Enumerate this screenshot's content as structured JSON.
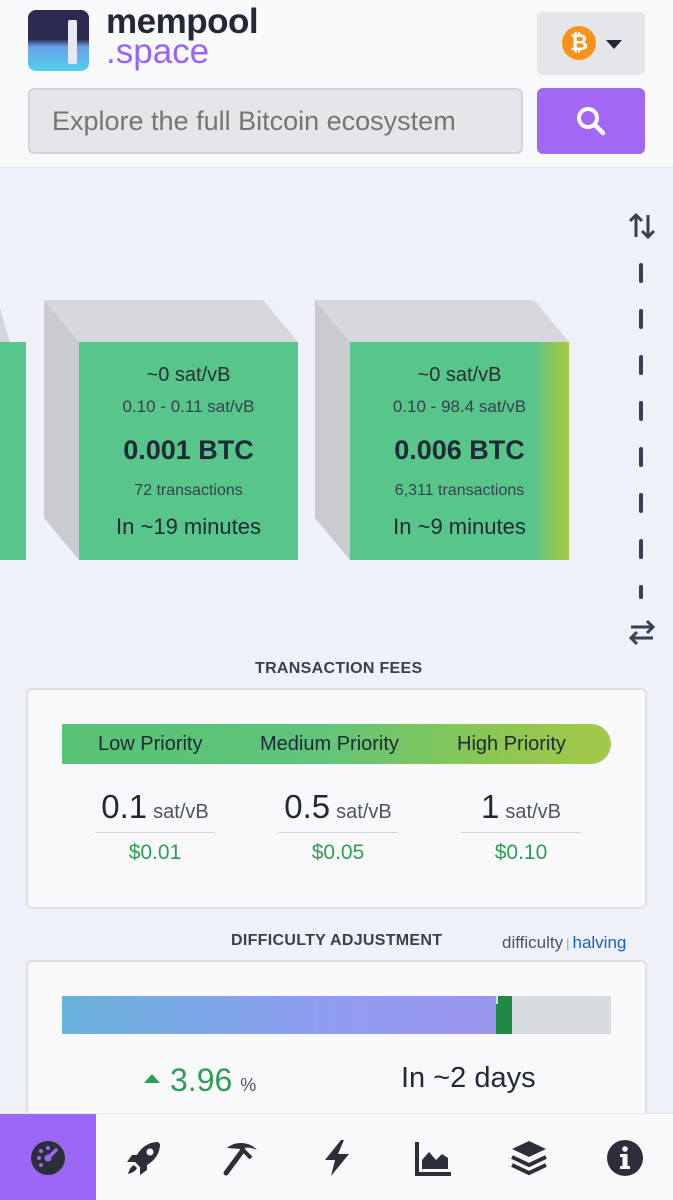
{
  "header": {
    "logo_line1": "mempool",
    "logo_line2": ".space",
    "network_symbol": "₿",
    "search_placeholder": "Explore the full Bitcoin ecosystem"
  },
  "mempool_blocks": [
    {
      "median_fee": "~0 sat/vB",
      "fee_range": "0.10 - 0.11 sat/vB",
      "total": "0.001 BTC",
      "tx_count": "72 transactions",
      "eta": "In ~19 minutes"
    },
    {
      "median_fee": "~0 sat/vB",
      "fee_range": "0.10 - 98.4 sat/vB",
      "total": "0.006 BTC",
      "tx_count": "6,311 transactions",
      "eta": "In ~9 minutes"
    }
  ],
  "fees": {
    "title": "TRANSACTION FEES",
    "priorities": [
      "Low Priority",
      "Medium Priority",
      "High Priority"
    ],
    "values": [
      {
        "value": "0.1",
        "unit": "sat/vB",
        "usd": "$0.01"
      },
      {
        "value": "0.5",
        "unit": "sat/vB",
        "usd": "$0.05"
      },
      {
        "value": "1",
        "unit": "sat/vB",
        "usd": "$0.10"
      }
    ]
  },
  "difficulty": {
    "title": "DIFFICULTY ADJUSTMENT",
    "toggle_a": "difficulty",
    "toggle_sep": "|",
    "toggle_b": "halving",
    "progress_fraction": 0.79,
    "change": "3.96",
    "change_unit": "%",
    "eta": "In ~2 days"
  },
  "nav": {
    "icons": [
      "dashboard-icon",
      "rocket-icon",
      "mining-pickaxe-icon",
      "lightning-icon",
      "graphs-icon",
      "layers-icon",
      "info-icon"
    ],
    "active": "dashboard-icon"
  },
  "colors": {
    "accent": "#9b68f5",
    "block_green": "#58c58a",
    "positive": "#2f9e55",
    "link": "#1b5fc4",
    "bitcoin": "#f7931a"
  }
}
